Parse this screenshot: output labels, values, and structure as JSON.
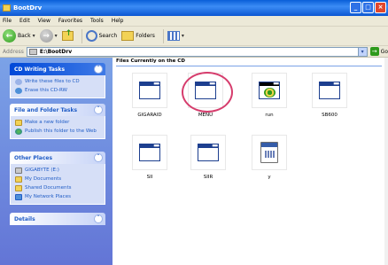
{
  "window": {
    "title": "BootDrv"
  },
  "menu": [
    {
      "label": "File",
      "accel": "F"
    },
    {
      "label": "Edit",
      "accel": "E"
    },
    {
      "label": "View",
      "accel": "V"
    },
    {
      "label": "Favorites",
      "accel": "a"
    },
    {
      "label": "Tools",
      "accel": "T"
    },
    {
      "label": "Help",
      "accel": "H"
    }
  ],
  "toolbar": {
    "back_label": "Back",
    "search_label": "Search",
    "folders_label": "Folders"
  },
  "address": {
    "label": "Address",
    "path": "E:\\BootDrv",
    "go_label": "Go"
  },
  "taskpane": {
    "cd_tasks": {
      "title": "CD Writing Tasks",
      "items": [
        "Write these files to CD",
        "Erase this CD-RW"
      ]
    },
    "file_tasks": {
      "title": "File and Folder Tasks",
      "items": [
        "Make a new folder",
        "Publish this folder to the Web"
      ]
    },
    "other_places": {
      "title": "Other Places",
      "items": [
        "GIGABYTE (E:)",
        "My Documents",
        "Shared Documents",
        "My Network Places"
      ]
    },
    "details": {
      "title": "Details"
    }
  },
  "content": {
    "section_title": "Files Currently on the CD",
    "files": [
      {
        "name": "GIGARAID",
        "icon": "window-app-icon"
      },
      {
        "name": "MENU",
        "icon": "window-app-icon"
      },
      {
        "name": "run",
        "icon": "gear-app-icon"
      },
      {
        "name": "SB600",
        "icon": "window-app-icon"
      },
      {
        "name": "SII",
        "icon": "window-app-icon"
      },
      {
        "name": "SIIR",
        "icon": "window-app-icon"
      },
      {
        "name": "y",
        "icon": "document-icon"
      }
    ]
  },
  "colors": {
    "highlight_circle": "#d63d6d",
    "taskpane_bg": "#6375d6",
    "titlebar": "#0a5fd8"
  }
}
